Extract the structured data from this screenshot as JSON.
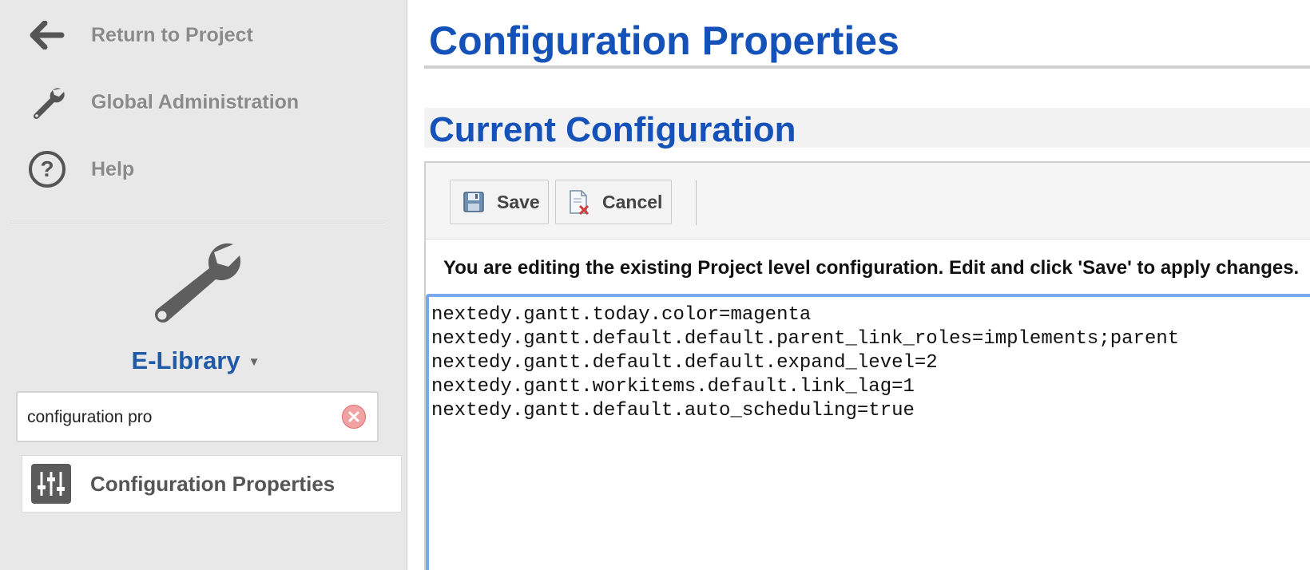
{
  "sidebar": {
    "nav": [
      {
        "label": "Return to Project",
        "icon": "arrow-left-icon"
      },
      {
        "label": "Global Administration",
        "icon": "wrench-icon"
      },
      {
        "label": "Help",
        "icon": "help-icon"
      }
    ],
    "project": {
      "name": "E-Library",
      "caret": "▼"
    },
    "search": {
      "value": "configuration pro"
    },
    "results": [
      {
        "label": "Configuration Properties",
        "icon": "sliders-icon"
      }
    ]
  },
  "main": {
    "page_title": "Configuration Properties",
    "section_title": "Current Configuration",
    "toolbar": {
      "save_label": "Save",
      "cancel_label": "Cancel"
    },
    "info_text": "You are editing the existing Project level configuration. Edit and click 'Save' to apply changes.",
    "config_text": "nextedy.gantt.today.color=magenta\nnextedy.gantt.default.default.parent_link_roles=implements;parent\nnextedy.gantt.default.default.expand_level=2\nnextedy.gantt.workitems.default.link_lag=1\nnextedy.gantt.default.auto_scheduling=true"
  },
  "colors": {
    "accent_blue": "#1451b8",
    "project_blue": "#1f5aa8",
    "focus_border": "#7ba7ec",
    "sidebar_bg": "#e8e8e8"
  }
}
